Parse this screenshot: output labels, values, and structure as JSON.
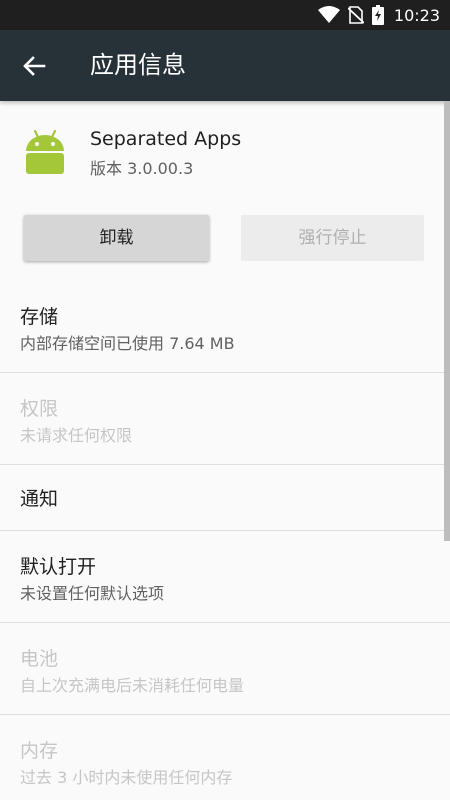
{
  "status_bar": {
    "time": "10:23",
    "icons": [
      "wifi-icon",
      "no-sim-icon",
      "battery-charging-icon"
    ]
  },
  "toolbar": {
    "title": "应用信息",
    "back_icon": "arrow-back-icon"
  },
  "app": {
    "icon": "android-icon",
    "name": "Separated Apps",
    "version": "版本 3.0.00.3"
  },
  "buttons": {
    "uninstall": "卸载",
    "force_stop": "强行停止"
  },
  "settings": [
    {
      "title": "存储",
      "summary": "内部存储空间已使用 7.64 MB",
      "enabled": true
    },
    {
      "title": "权限",
      "summary": "未请求任何权限",
      "enabled": false
    },
    {
      "title": "通知",
      "summary": "",
      "enabled": true
    },
    {
      "title": "默认打开",
      "summary": "未设置任何默认选项",
      "enabled": true
    },
    {
      "title": "电池",
      "summary": "自上次充满电后未消耗任何电量",
      "enabled": false
    },
    {
      "title": "内存",
      "summary": "过去 3 小时内未使用任何内存",
      "enabled": false
    }
  ],
  "colors": {
    "toolbar": "#263238",
    "status_bar": "#1f1f1f",
    "android_green": "#a4c639"
  }
}
